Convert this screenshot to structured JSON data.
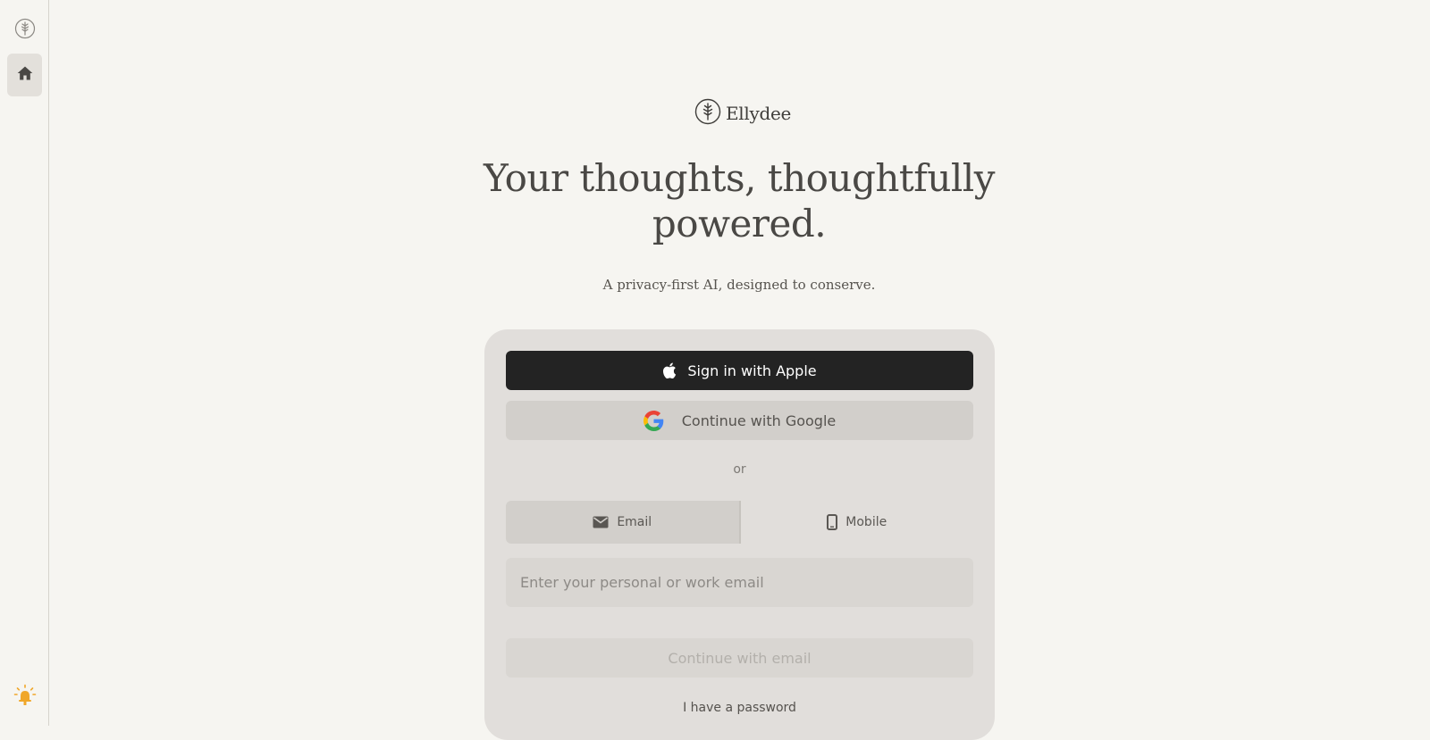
{
  "brand": {
    "name": "Ellydee",
    "logo_icon": "tree-leaf-logo-icon"
  },
  "sidebar": {
    "logo_icon": "tree-leaf-logo-icon",
    "home_icon": "home-icon",
    "bulb_icon": "lightbulb-icon"
  },
  "hero": {
    "headline": "Your thoughts, thoughtfully powered.",
    "subtitle": "A privacy-first AI, designed to conserve."
  },
  "auth": {
    "apple_label": "Sign in with Apple",
    "google_label": "Continue with Google",
    "divider": "or",
    "tabs": [
      {
        "label": "Email",
        "icon": "mail-icon",
        "selected": true
      },
      {
        "label": "Mobile",
        "icon": "phone-icon",
        "selected": false
      }
    ],
    "email_placeholder": "Enter your personal or work email",
    "email_value": "",
    "continue_label": "Continue with email",
    "password_link": "I have a password"
  },
  "colors": {
    "background": "#f6f5f1",
    "card": "#e1dedb",
    "apple_button": "#232323",
    "bulb_accent": "#f0a72a"
  }
}
